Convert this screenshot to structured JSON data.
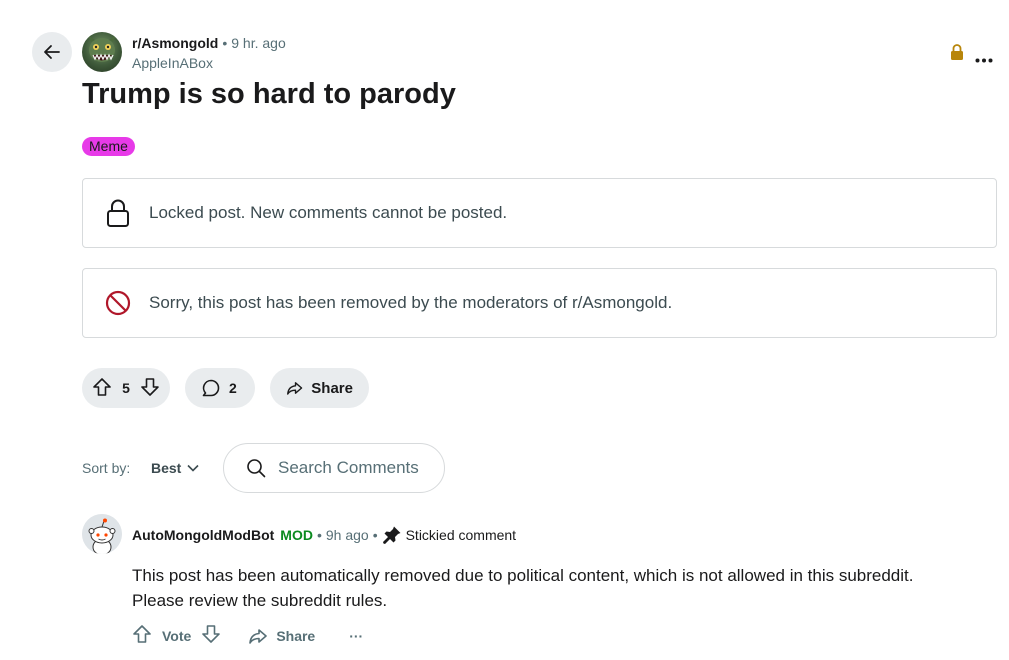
{
  "post": {
    "subreddit": "r/Asmongold",
    "separator": "•",
    "time": "9 hr. ago",
    "author": "AppleInABox",
    "title": "Trump is so hard to parody",
    "flair": "Meme",
    "flair_color": "#e73ae8"
  },
  "notices": {
    "locked": "Locked post. New comments cannot be posted.",
    "removed": "Sorry, this post has been removed by the moderators of r/Asmongold."
  },
  "actions": {
    "score": "5",
    "comments": "2",
    "share": "Share"
  },
  "sort": {
    "label": "Sort by:",
    "value": "Best"
  },
  "search": {
    "placeholder": "Search Comments"
  },
  "comment": {
    "author": "AutoMongoldModBot",
    "mod_badge": "MOD",
    "separator": "•",
    "time": "9h ago",
    "stickied": "Stickied comment",
    "body_line1": "This post has been automatically removed due to political content, which is not allowed in this subreddit.",
    "body_line2": "Please review the subreddit rules.",
    "vote_label": "Vote",
    "share_label": "Share",
    "more": "···"
  },
  "icons": {
    "back": "arrow-left-icon",
    "lock": "lock-icon",
    "more": "more-horizontal-icon",
    "ban": "ban-icon",
    "upvote": "upvote-icon",
    "downvote": "downvote-icon",
    "comment": "comment-icon",
    "share": "share-icon",
    "search": "search-icon",
    "chevron": "chevron-down-icon",
    "pin": "pin-icon"
  },
  "colors": {
    "lock_gold": "#b8860b",
    "ban_red": "#b0172a",
    "mod_green": "#0b8a1f",
    "pill_bg": "#e9ecee"
  }
}
